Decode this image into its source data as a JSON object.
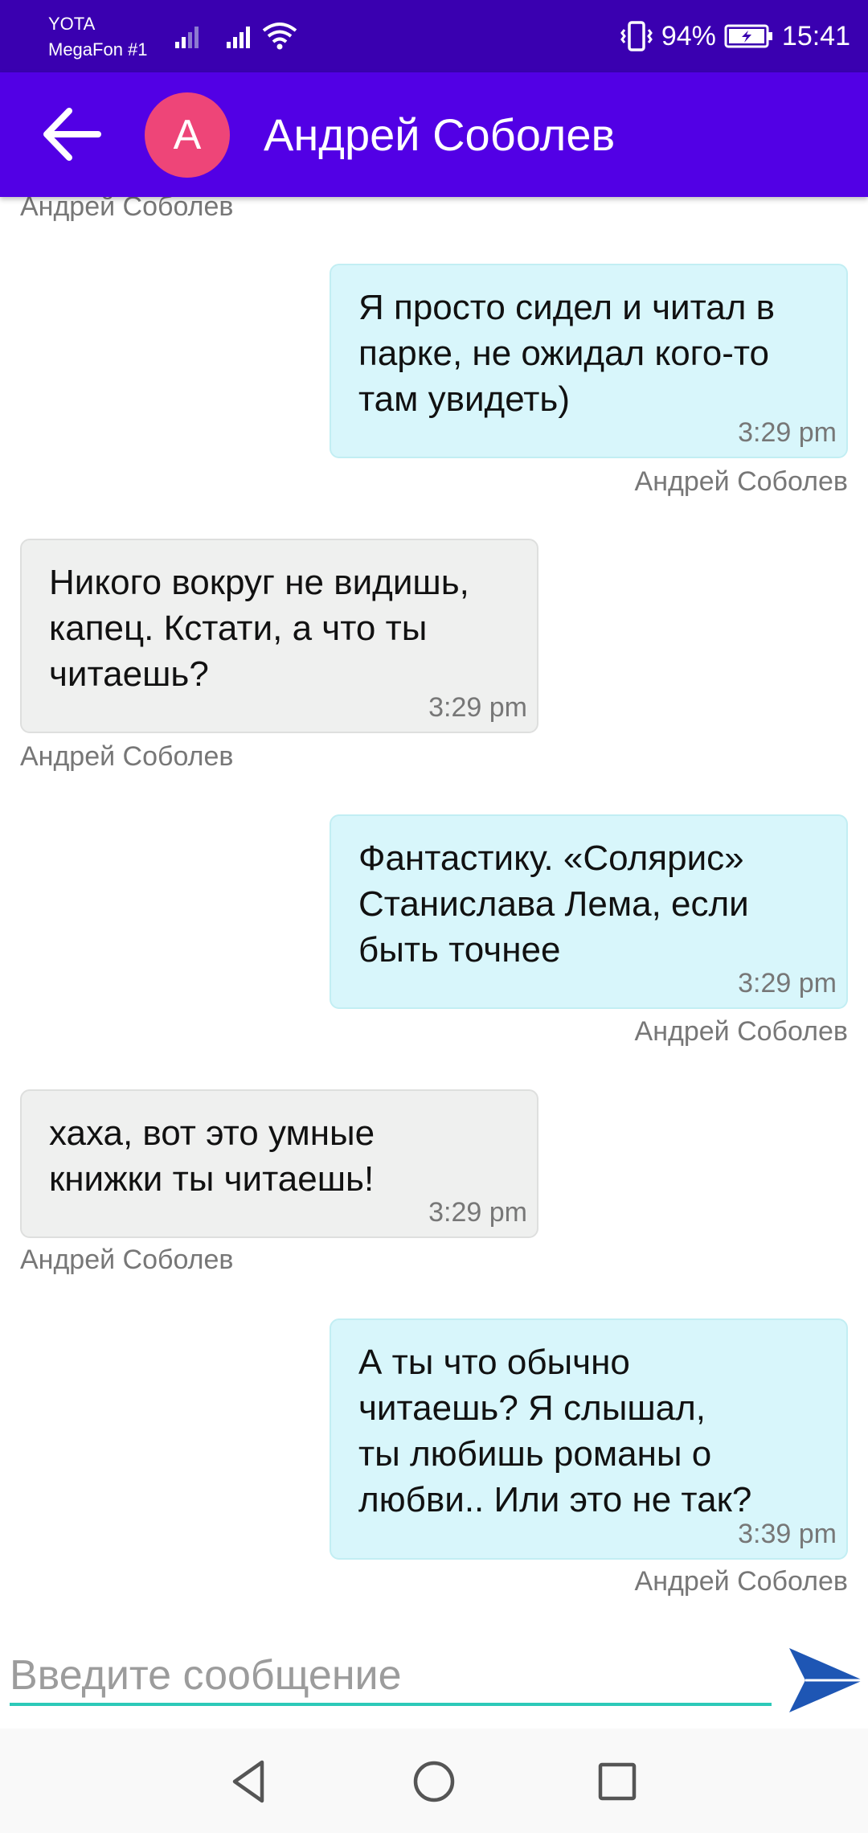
{
  "status_bar": {
    "carrier1": "YOTA",
    "carrier2": "MegaFon #1",
    "battery": "94%",
    "time": "15:41"
  },
  "header": {
    "avatar_letter": "A",
    "contact_name": "Андрей Соболев"
  },
  "messages": [
    {
      "type": "sender_only",
      "sender": "Андрей Соболев"
    },
    {
      "direction": "out",
      "text": "Я просто сидел и читал в\nпарке, не ожидал кого-то\nтам увидеть)",
      "time": "3:29 pm",
      "sender": "Андрей Соболев"
    },
    {
      "direction": "in",
      "text": "Никого вокруг не видишь,\nкапец. Кстати, а что ты\nчитаешь?",
      "time": "3:29 pm",
      "sender": "Андрей Соболев"
    },
    {
      "direction": "out",
      "text": "Фантастику. «Солярис»\nСтанислава Лема, если\nбыть точнее",
      "time": "3:29 pm",
      "sender": "Андрей Соболев"
    },
    {
      "direction": "in",
      "text": "хаха, вот это умные\nкнижки ты читаешь!",
      "time": "3:29 pm",
      "sender": "Андрей Соболев"
    },
    {
      "direction": "out",
      "text": "А ты что обычно\nчитаешь? Я слышал,\nты любишь романы о\nлюбви.. Или это не так?",
      "time": "3:39 pm",
      "sender": "Андрей Соболев"
    }
  ],
  "composer": {
    "placeholder": "Введите сообщение",
    "value": ""
  },
  "colors": {
    "status_bar": "#3a00b0",
    "app_bar": "#5200e5",
    "avatar": "#ee4578",
    "outgoing_bubble": "#d8f6fb",
    "incoming_bubble": "#eff0ef",
    "input_underline": "#2cc9b8",
    "send_icon": "#1e56b4"
  },
  "icons": {
    "back": "arrow-left-icon",
    "send": "send-icon",
    "nav_back": "triangle-back-icon",
    "nav_home": "circle-home-icon",
    "nav_recents": "square-recents-icon"
  }
}
